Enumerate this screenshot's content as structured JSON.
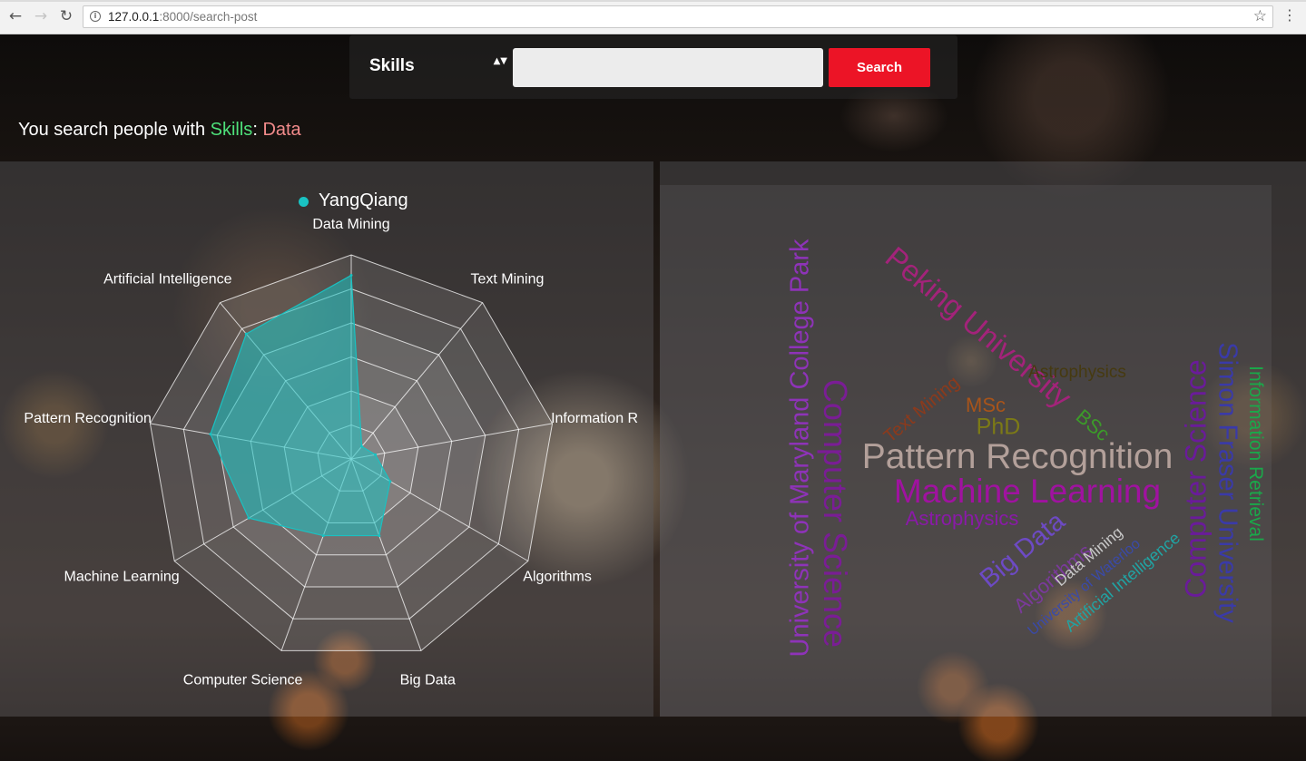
{
  "browser": {
    "url_host": "127.0.0.1",
    "url_rest": ":8000/search-post",
    "back_glyph": "←",
    "forward_glyph": "→",
    "reload_glyph": "↻",
    "info_glyph": "i",
    "star_glyph": "☆",
    "menu_glyph": "⋮"
  },
  "search": {
    "category_value": "Skills",
    "arrows_glyph": "▲▼",
    "input_value": "",
    "input_placeholder": "",
    "button_label": "Search"
  },
  "summary": {
    "prefix": "You search people with ",
    "category": "Skills",
    "separator": ": ",
    "query": "Data"
  },
  "colors": {
    "accent_red": "#ec1426",
    "radar_series": "#19c2c2",
    "category_green": "#4ee07a",
    "query_pink": "#f28b8b"
  },
  "chart_data": {
    "type": "radar",
    "legend": [
      "YangQiang"
    ],
    "legend_placement": "top-center",
    "axes": [
      "Data Mining",
      "Text Mining",
      "Information R",
      "Algorithms",
      "Big Data",
      "Computer Science",
      "Machine Learning",
      "Pattern Recognition",
      "Artificial Intelligence"
    ],
    "max": 100,
    "rings": 6,
    "series": [
      {
        "name": "YangQiang",
        "values": [
          90,
          8,
          12,
          22,
          40,
          40,
          58,
          70,
          80
        ]
      }
    ]
  },
  "wordcloud": {
    "words": [
      {
        "text": "University of Maryland College Park",
        "color": "#8e33b8"
      },
      {
        "text": "Computer Science",
        "color": "#7a1d95"
      },
      {
        "text": "Peking University",
        "color": "#a3237a"
      },
      {
        "text": "Text Mining",
        "color": "#8c3a1c"
      },
      {
        "text": "Astrophysics",
        "color": "#463a10"
      },
      {
        "text": "MSc",
        "color": "#a8541a"
      },
      {
        "text": "PhD",
        "color": "#7c7a16"
      },
      {
        "text": "BSc",
        "color": "#3c9a2a"
      },
      {
        "text": "Pattern Recognition",
        "color": "#b3a09a"
      },
      {
        "text": "Machine Learning",
        "color": "#a012a0"
      },
      {
        "text": "Astrophysics",
        "color": "#8a1aa8"
      },
      {
        "text": "Big Data",
        "color": "#6d4ac4"
      },
      {
        "text": "Algorithms",
        "color": "#7a3a9a"
      },
      {
        "text": "Data Mining",
        "color": "#c8c8c8"
      },
      {
        "text": "University of Waterloo",
        "color": "#3a4aa8"
      },
      {
        "text": "Artificial Intelligence",
        "color": "#21a3a3"
      },
      {
        "text": "Computer Science",
        "color": "#6a1b9a"
      },
      {
        "text": "Simon Fraser University",
        "color": "#3a3aa8"
      },
      {
        "text": "Information Retrieval",
        "color": "#1aa84a"
      }
    ]
  }
}
